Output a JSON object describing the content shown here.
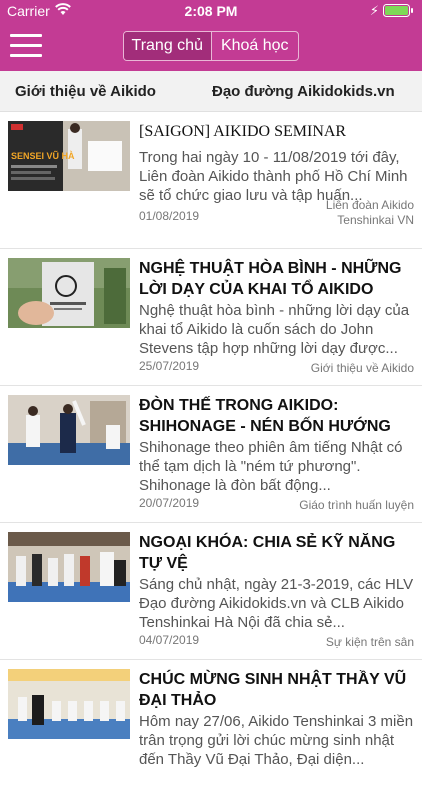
{
  "status": {
    "carrier": "Carrier",
    "time": "2:08 PM"
  },
  "nav": {
    "segments": [
      "Trang chủ",
      "Khoá học"
    ],
    "selected": "Trang chủ"
  },
  "tabs": [
    "Giới thiệu về Aikido",
    "Đạo đường Aikidokids.vn"
  ],
  "articles": [
    {
      "title": "[SAIGON] AIKIDO SEMINAR",
      "excerpt": "Trong hai ngày 10 - 11/08/2019 tới đây, Liên đoàn Aikido thành phố Hồ Chí Minh sẽ tổ chức giao lưu và tập huấn...",
      "date": "01/08/2019",
      "category": "Liên đoàn Aikido Tenshinkai VN",
      "thumb_text": "SENSEI VŨ HÀ"
    },
    {
      "title": "NGHỆ THUẬT HÒA BÌNH - NHỮNG LỜI DẠY CỦA KHAI TỔ AIKIDO",
      "excerpt": "Nghệ thuật hòa bình - những lời dạy của khai tổ Aikido là cuốn sách do John Stevens tập hợp những lời dạy được...",
      "date": "25/07/2019",
      "category": "Giới thiệu về Aikido"
    },
    {
      "title": "ĐÒN THẾ TRONG AIKIDO: SHIHONAGE - NÉN BỐN HƯỚNG",
      "excerpt": "Shihonage theo phiên âm tiếng Nhật có thể tạm dịch là \"ném tứ phương\". Shihonage là đòn bất động...",
      "date": "20/07/2019",
      "category": "Giáo trình huấn luyện"
    },
    {
      "title": "NGOẠI KHÓA: CHIA SẺ KỸ NĂNG TỰ VỆ",
      "excerpt": "Sáng chủ nhật, ngày 21-3-2019, các HLV Đạo đường Aikidokids.vn và CLB Aikido Tenshinkai Hà Nội đã chia sẻ...",
      "date": "04/07/2019",
      "category": "Sự kiện trên sân"
    },
    {
      "title": "CHÚC MỪNG SINH NHẬT THẦY VŨ ĐẠI THẢO",
      "excerpt": "Hôm nay 27/06, Aikido Tenshinkai 3 miền trân trọng gửi lời chúc mừng sinh nhật đến Thầy Vũ Đại Thảo, Đại diện...",
      "date": "",
      "category": ""
    }
  ]
}
